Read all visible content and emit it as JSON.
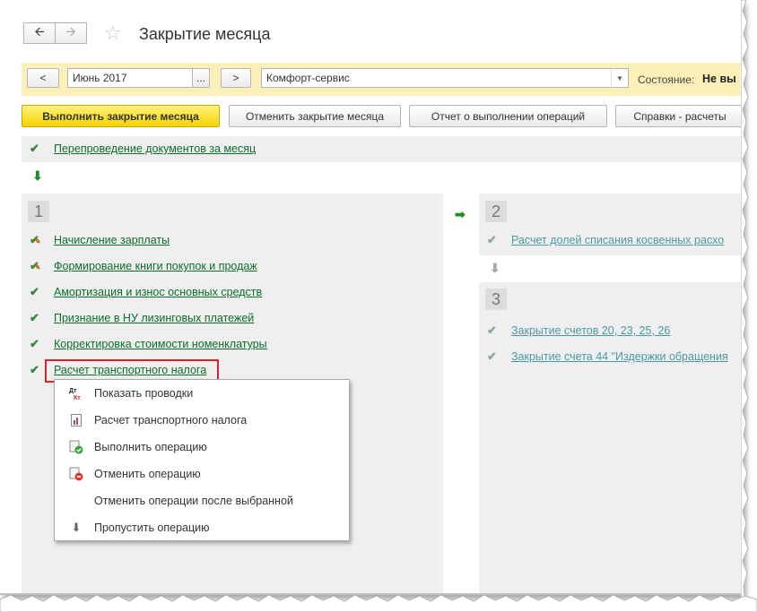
{
  "window": {
    "title": "Закрытие месяца"
  },
  "toolbar": {
    "prev_period": "<",
    "period_value": "Июнь 2017",
    "period_select": "...",
    "next_period": ">",
    "organization_value": "Комфорт-сервис",
    "status_label": "Состояние:",
    "status_value": "Не вы"
  },
  "actions": {
    "perform": "Выполнить закрытие месяца",
    "cancel": "Отменить закрытие месяца",
    "report": "Отчет о выполнении операций",
    "references": "Справки - расчеты"
  },
  "pre_step": {
    "label": "Перепроведение документов за месяц"
  },
  "stage1": {
    "number": "1",
    "items": [
      {
        "label": "Начисление зарплаты",
        "state": "done-warning"
      },
      {
        "label": "Формирование книги покупок и продаж",
        "state": "done-warning"
      },
      {
        "label": "Амортизация и износ основных средств",
        "state": "done"
      },
      {
        "label": "Признание в НУ лизинговых платежей",
        "state": "done"
      },
      {
        "label": "Корректировка стоимости номенклатуры",
        "state": "done"
      },
      {
        "label": "Расчет транспортного налога",
        "state": "done"
      }
    ]
  },
  "stage2": {
    "number": "2",
    "items": [
      {
        "label": "Расчет долей списания косвенных расхо"
      }
    ]
  },
  "stage3": {
    "number": "3",
    "items": [
      {
        "label": "Закрытие счетов 20, 23, 25, 26"
      },
      {
        "label": "Закрытие счета 44 \"Издержки обращения"
      }
    ]
  },
  "context_menu": {
    "items": [
      {
        "label": "Показать проводки",
        "icon": "dt-kt-icon"
      },
      {
        "label": "Расчет транспортного налога",
        "icon": "report-icon"
      },
      {
        "label": "Выполнить операцию",
        "icon": "execute-icon"
      },
      {
        "label": "Отменить операцию",
        "icon": "cancel-operation-icon"
      },
      {
        "label": "Отменить операции после выбранной",
        "icon": ""
      },
      {
        "label": "Пропустить операцию",
        "icon": "skip-arrow-icon"
      }
    ]
  },
  "colors": {
    "link": "#0d6d2a",
    "link_dim": "#4b9aa2",
    "yellow_panel": "#fbf0b9",
    "primary_button": "#f5d300",
    "highlight": "#d9232a"
  }
}
